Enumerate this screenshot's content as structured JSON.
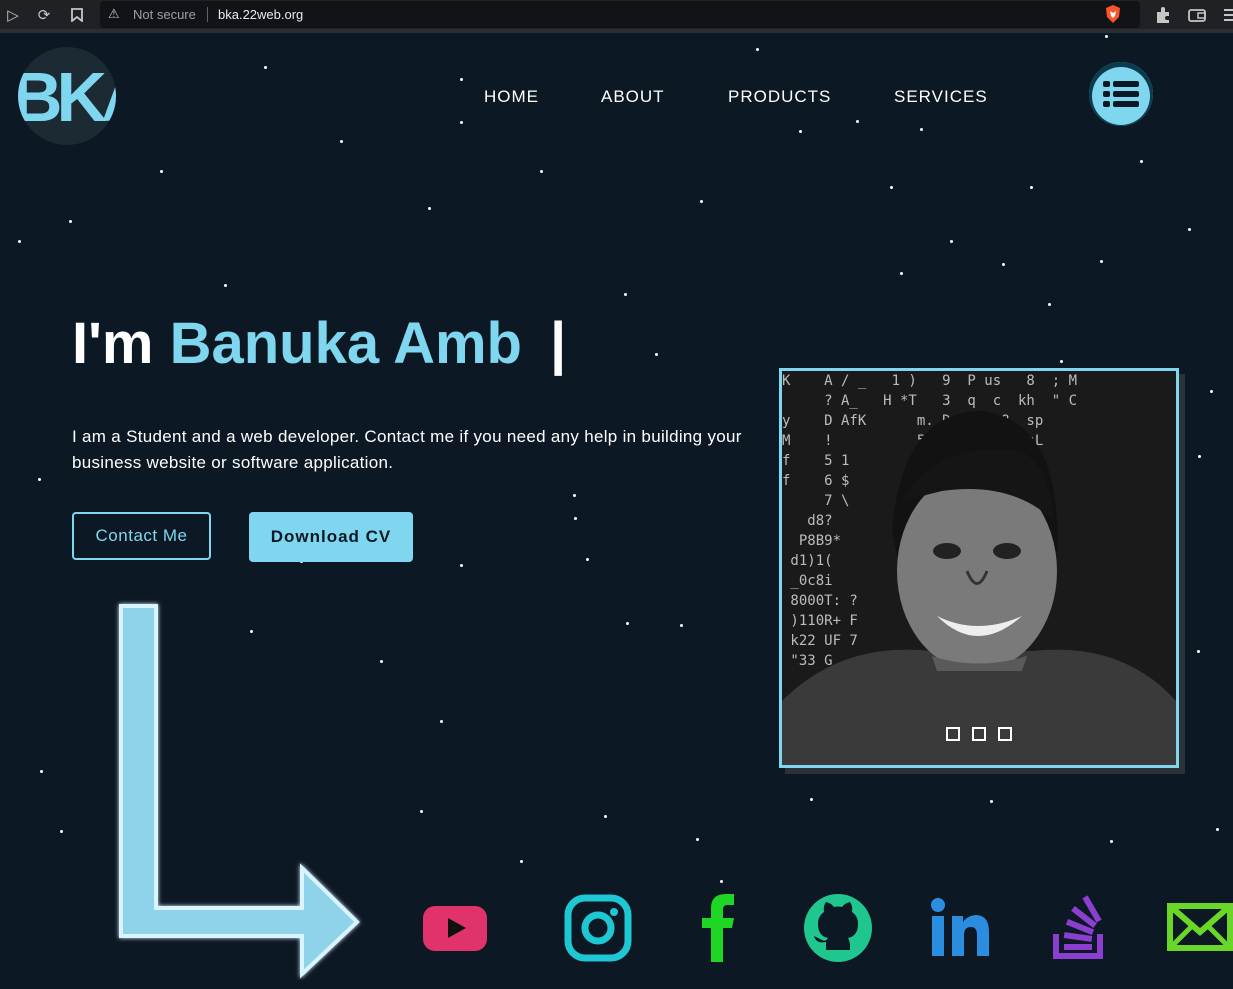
{
  "browser": {
    "security_label": "Not secure",
    "url": "bka.22web.org"
  },
  "site": {
    "logo_text": "BKA",
    "nav": [
      "HOME",
      "ABOUT",
      "PRODUCTS",
      "SERVICES"
    ],
    "hero": {
      "prefix": "I'm ",
      "name": "Banuka Amb",
      "cursor": "|",
      "description_line1": "I am a Student and a web developer. Contact me if you need any help in building your",
      "description_line2": "business website or software application."
    },
    "buttons": {
      "contact": "Contact Me",
      "download": "Download CV"
    },
    "social": [
      "youtube-icon",
      "instagram-icon",
      "facebook-icon",
      "github-icon",
      "linkedin-icon",
      "stackoverflow-icon",
      "email-icon"
    ]
  },
  "colors": {
    "background": "#0d1825",
    "accent": "#7fd6ef",
    "youtube": "#e0336b",
    "instagram": "#1fc7d4",
    "facebook": "#1fd624",
    "github": "#1fc78f",
    "linkedin": "#2a8de0",
    "stackoverflow": "#8a3fd1",
    "email": "#6bd62a"
  }
}
